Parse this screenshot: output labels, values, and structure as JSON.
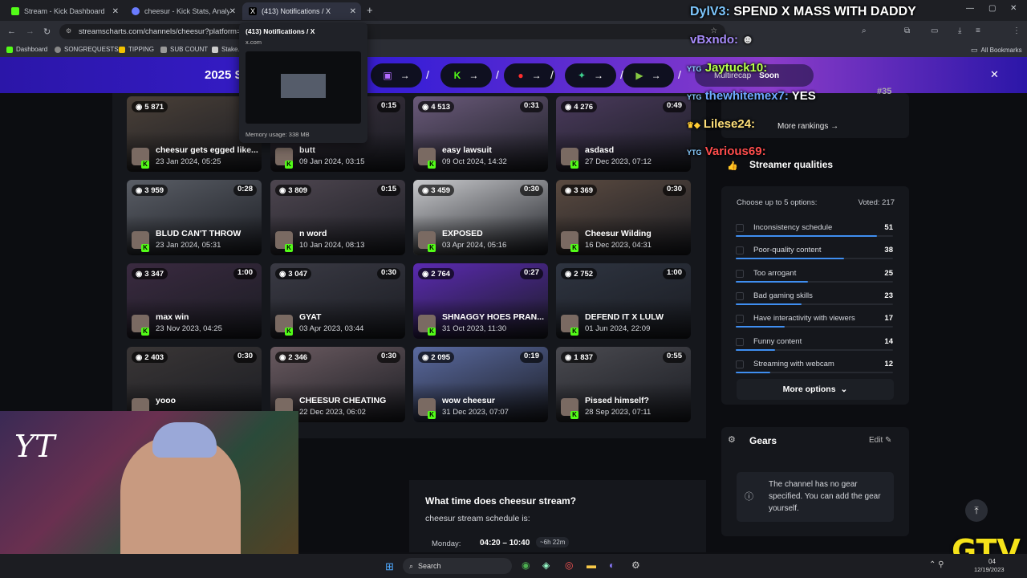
{
  "browser": {
    "tabs": [
      {
        "title": "Stream - Kick Dashboard",
        "color": "#53fc18"
      },
      {
        "title": "cheesur - Kick Stats, Analytics a",
        "color": "#6a7cff"
      },
      {
        "title": "(413) Notifications / X",
        "color": "#ffffff"
      }
    ],
    "url": "streamscharts.com/channels/cheesur?platform=kick",
    "bookmarks": [
      "Dashboard",
      "SONGREQUESTS",
      "TIPPING",
      "SUB COUNT",
      "Stake.u",
      "All Bookmarks"
    ],
    "tooltip": {
      "title": "(413) Notifications / X",
      "domain": "x.com",
      "memory": "Memory usage: 338 MB"
    }
  },
  "banner": {
    "year_text": "2025 S",
    "multirecap_label": "Multirecap",
    "soon_label": "Soon",
    "close": "✕"
  },
  "clips": [
    {
      "views": "5 871",
      "duration": "",
      "title": "cheesur gets egged like...",
      "date": "23 Jan 2024, 05:25"
    },
    {
      "views": "",
      "duration": "0:15",
      "title": "butt",
      "date": "09 Jan 2024, 03:15"
    },
    {
      "views": "4 513",
      "duration": "0:31",
      "title": "easy lawsuit",
      "date": "09 Oct 2024, 14:32"
    },
    {
      "views": "4 276",
      "duration": "0:49",
      "title": "asdasd",
      "date": "27 Dec 2023, 07:12"
    },
    {
      "views": "3 959",
      "duration": "0:28",
      "title": "BLUD CAN'T THROW",
      "date": "23 Jan 2024, 05:31"
    },
    {
      "views": "3 809",
      "duration": "0:15",
      "title": "n word",
      "date": "10 Jan 2024, 08:13"
    },
    {
      "views": "3 459",
      "duration": "0:30",
      "title": "EXPOSED",
      "date": "03 Apr 2024, 05:16"
    },
    {
      "views": "3 369",
      "duration": "0:30",
      "title": "Cheesur Wilding",
      "date": "16 Dec 2023, 04:31"
    },
    {
      "views": "3 347",
      "duration": "1:00",
      "title": "max win",
      "date": "23 Nov 2023, 04:25"
    },
    {
      "views": "3 047",
      "duration": "0:30",
      "title": "GYAT",
      "date": "03 Apr 2023, 03:44"
    },
    {
      "views": "2 764",
      "duration": "0:27",
      "title": "SHNAGGY HOES PRAN...",
      "date": "31 Oct 2023, 11:30"
    },
    {
      "views": "2 752",
      "duration": "1:00",
      "title": "DEFEND IT X LULW",
      "date": "01 Jun 2024, 22:09"
    },
    {
      "views": "2 403",
      "duration": "0:30",
      "title": "yooo",
      "date": ""
    },
    {
      "views": "2 346",
      "duration": "0:30",
      "title": "CHEESUR CHEATING",
      "date": "22 Dec 2023, 06:02"
    },
    {
      "views": "2 095",
      "duration": "0:19",
      "title": "wow cheesur",
      "date": "31 Dec 2023, 07:07"
    },
    {
      "views": "1 837",
      "duration": "0:55",
      "title": "Pissed himself?",
      "date": "28 Sep 2023, 07:11"
    }
  ],
  "sidebar": {
    "rank_text": "#35",
    "more_rankings": "More rankings",
    "qualities": {
      "title": "Streamer qualities",
      "hint": "Choose up to 5 options:",
      "voted": "Voted: 217",
      "options": [
        {
          "label": "Inconsistency schedule",
          "count": "51",
          "share": 0.9
        },
        {
          "label": "Poor-quality content",
          "count": "38",
          "share": 0.69
        },
        {
          "label": "Too arrogant",
          "count": "25",
          "share": 0.46
        },
        {
          "label": "Bad gaming skills",
          "count": "23",
          "share": 0.42
        },
        {
          "label": "Have interactivity with viewers",
          "count": "17",
          "share": 0.31
        },
        {
          "label": "Funny content",
          "count": "14",
          "share": 0.25
        },
        {
          "label": "Streaming with webcam",
          "count": "12",
          "share": 0.22
        }
      ],
      "more_options": "More options"
    },
    "gears": {
      "title": "Gears",
      "edit": "Edit",
      "empty_text": "The channel has no gear specified. You can add the gear yourself."
    }
  },
  "schedule": {
    "question": "What time does cheesur stream?",
    "intro": "cheesur stream schedule is:",
    "rows": [
      {
        "day": "Monday:",
        "time": "04:20 – 10:40",
        "duration": "~6h 22m"
      }
    ]
  },
  "chat": [
    {
      "user": "DylV3:",
      "message": "SPEND X MASS WITH DADDY",
      "color": "#7ec8ff"
    },
    {
      "user": "vBxndo:",
      "message": "",
      "color": "#a78bfa"
    },
    {
      "user": "Jaytuck10:",
      "message": "",
      "color": "#b6ff4a"
    },
    {
      "user": "thewhitemex7:",
      "message": "YES",
      "color": "#6fa8ff"
    },
    {
      "user": "Lilese24:",
      "message": "",
      "color": "#ffe07a"
    },
    {
      "user": "Various69:",
      "message": "",
      "color": "#ff4d4d"
    }
  ],
  "taskbar": {
    "search": "Search",
    "date": "12/19/2023",
    "time": "04"
  },
  "overlay": {
    "webcam_text": "YT",
    "logo": "GTV"
  }
}
